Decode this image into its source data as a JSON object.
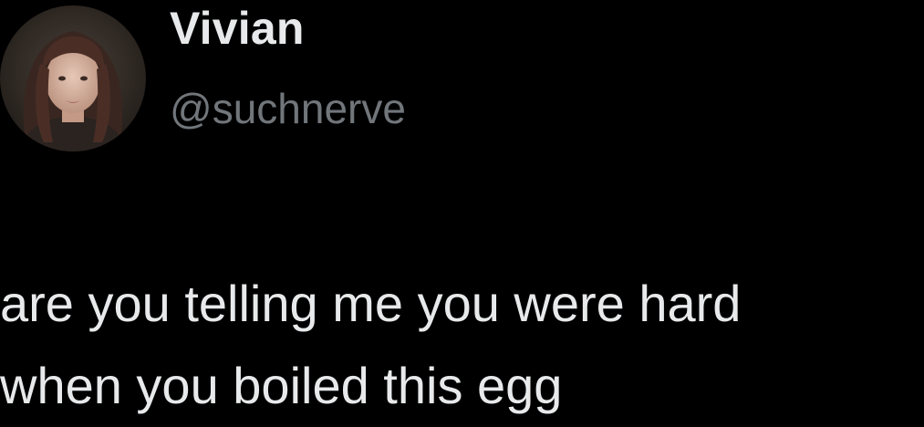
{
  "author": {
    "display_name": "Vivian",
    "handle": "@suchnerve",
    "avatar_icon": "profile-photo-avatar"
  },
  "tweet": {
    "lines": [
      "are you telling me you were hard",
      "when you boiled this egg"
    ]
  },
  "colors": {
    "background": "#000000",
    "primary_text": "#e7e9ea",
    "secondary_text": "#71767b"
  }
}
